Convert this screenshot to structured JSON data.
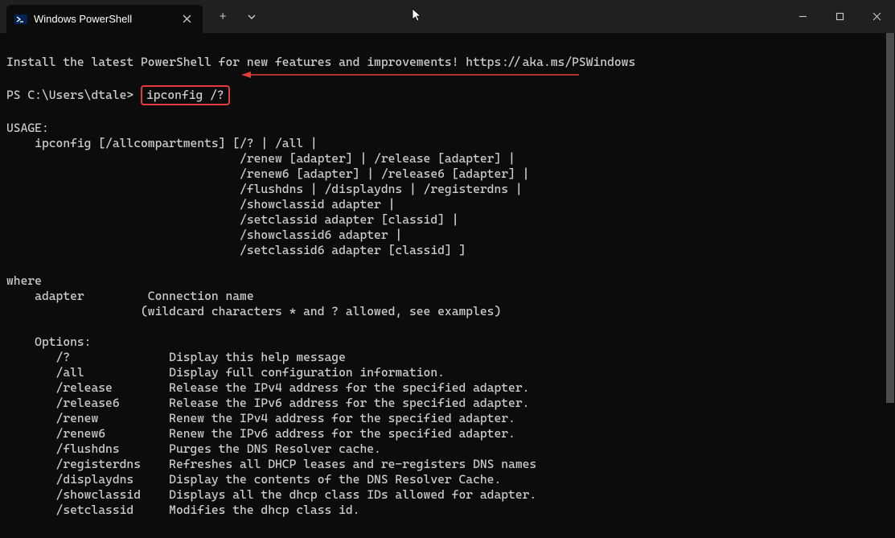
{
  "window": {
    "tab_title": "Windows PowerShell",
    "new_tab_glyph": "+",
    "dropdown_glyph": "v"
  },
  "terminal": {
    "install_line": "Install the latest PowerShell for new features and improvements! https://aka.ms/PSWindows",
    "prompt": "PS C:\\Users\\dtale>",
    "command": "ipconfig /?",
    "usage_header": "USAGE:",
    "usage_lines": [
      "    ipconfig [/allcompartments] [/? | /all |",
      "                                 /renew [adapter] | /release [adapter] |",
      "                                 /renew6 [adapter] | /release6 [adapter] |",
      "                                 /flushdns | /displaydns | /registerdns |",
      "                                 /showclassid adapter |",
      "                                 /setclassid adapter [classid] |",
      "                                 /showclassid6 adapter |",
      "                                 /setclassid6 adapter [classid] ]"
    ],
    "where_header": "where",
    "where_lines": [
      "    adapter         Connection name",
      "                   (wildcard characters * and ? allowed, see examples)"
    ],
    "options_header": "    Options:",
    "options": [
      {
        "flag": "/?",
        "desc": "Display this help message"
      },
      {
        "flag": "/all",
        "desc": "Display full configuration information."
      },
      {
        "flag": "/release",
        "desc": "Release the IPv4 address for the specified adapter."
      },
      {
        "flag": "/release6",
        "desc": "Release the IPv6 address for the specified adapter."
      },
      {
        "flag": "/renew",
        "desc": "Renew the IPv4 address for the specified adapter."
      },
      {
        "flag": "/renew6",
        "desc": "Renew the IPv6 address for the specified adapter."
      },
      {
        "flag": "/flushdns",
        "desc": "Purges the DNS Resolver cache."
      },
      {
        "flag": "/registerdns",
        "desc": "Refreshes all DHCP leases and re-registers DNS names"
      },
      {
        "flag": "/displaydns",
        "desc": "Display the contents of the DNS Resolver Cache."
      },
      {
        "flag": "/showclassid",
        "desc": "Displays all the dhcp class IDs allowed for adapter."
      },
      {
        "flag": "/setclassid",
        "desc": "Modifies the dhcp class id."
      }
    ]
  }
}
